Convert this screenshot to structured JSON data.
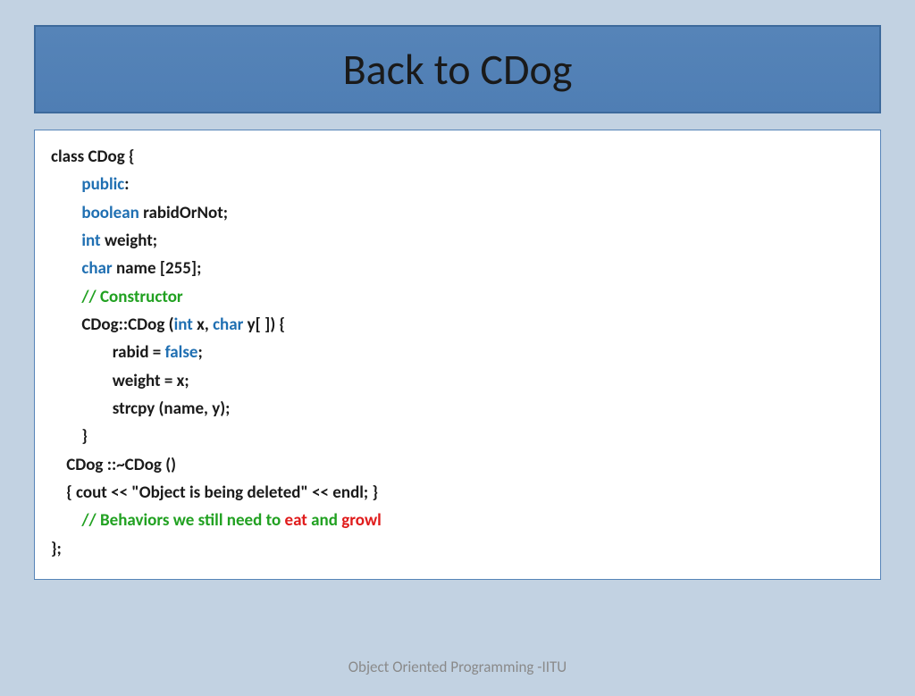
{
  "title": "Back to CDog",
  "footer": "Object Oriented Programming -IITU",
  "code": {
    "l1_a": "class CDog {",
    "l2_kw": "public",
    "l2_b": ":",
    "l3_kw": "boolean",
    "l3_b": " rabidOrNot;",
    "l4_kw": "int",
    "l4_b": " weight;",
    "l5_kw": "char",
    "l5_b": " name [255];",
    "l6_cmt": "// Constructor",
    "l7_a": "CDog::CDog (",
    "l7_kw1": "int",
    "l7_b": " x, ",
    "l7_kw2": "char",
    "l7_c": " y[ ]) {",
    "l8_a": "rabid = ",
    "l8_kw": "false",
    "l8_b": ";",
    "l9_a": "weight = x;",
    "l10_a": "strcpy (name, y);",
    "l11_a": "}",
    "l12_a": "CDog ::~CDog ()",
    "l13_a": "{ cout << \"Object is being deleted\" << endl; }",
    "l14_cmt_a": "// Behaviors we still need to ",
    "l14_kw1": "eat",
    "l14_cmt_b": " and ",
    "l14_kw2": "growl",
    "l15_a": "};"
  }
}
